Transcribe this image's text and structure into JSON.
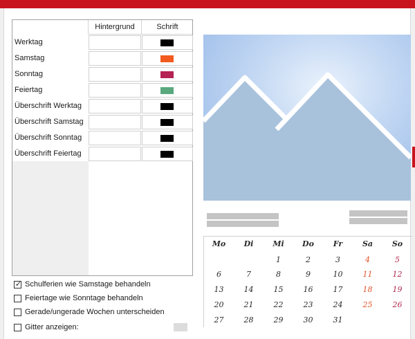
{
  "colors": {
    "topbar": "#c8141c",
    "black": "#000000",
    "samstag": "#f25a1e",
    "sonntag": "#b52254",
    "feiertag": "#5aa87e"
  },
  "table": {
    "header_background": "Hintergrund",
    "header_font": "Schrift",
    "rows": [
      {
        "label": "Werktag",
        "font_color": "#000000"
      },
      {
        "label": "Samstag",
        "font_color": "#f25a1e"
      },
      {
        "label": "Sonntag",
        "font_color": "#b52254"
      },
      {
        "label": "Feiertag",
        "font_color": "#5aa87e"
      },
      {
        "label": "Überschrift Werktag",
        "font_color": "#000000"
      },
      {
        "label": "Überschrift Samstag",
        "font_color": "#000000"
      },
      {
        "label": "Überschrift Sonntag",
        "font_color": "#000000"
      },
      {
        "label": "Überschrift Feiertag",
        "font_color": "#000000"
      }
    ]
  },
  "options": [
    {
      "label": "Schulferien wie Samstage behandeln",
      "checked": true
    },
    {
      "label": "Feiertage wie Sonntage behandeln",
      "checked": false
    },
    {
      "label": "Gerade/ungerade Wochen unterscheiden",
      "checked": false
    },
    {
      "label": "Gitter anzeigen:",
      "checked": false
    }
  ],
  "preview": {
    "image_icon": "image-placeholder-icon"
  },
  "calendar": {
    "weekdays": [
      "Mo",
      "Di",
      "Mi",
      "Do",
      "Fr",
      "Sa",
      "So"
    ],
    "weeks": [
      [
        "",
        "",
        "1",
        "2",
        "3",
        "4",
        "5"
      ],
      [
        "6",
        "7",
        "8",
        "9",
        "10",
        "11",
        "12"
      ],
      [
        "13",
        "14",
        "15",
        "16",
        "17",
        "18",
        "19"
      ],
      [
        "20",
        "21",
        "22",
        "23",
        "24",
        "25",
        "26"
      ],
      [
        "27",
        "28",
        "29",
        "30",
        "31",
        "",
        ""
      ]
    ]
  }
}
